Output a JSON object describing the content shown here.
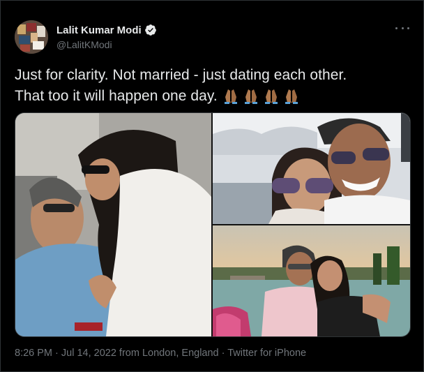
{
  "author": {
    "name": "Lalit Kumar Modi",
    "handle": "@LalitKModi",
    "verified": true
  },
  "tweet": {
    "line1": "Just for clarity. Not married - just dating each other.",
    "line2": "That too it will happen one day.",
    "emoji": [
      "folded-hands-icon",
      "folded-hands-icon",
      "folded-hands-icon",
      "folded-hands-icon"
    ]
  },
  "media": {
    "photos": [
      {
        "name": "photo-couple-embrace"
      },
      {
        "name": "photo-couple-selfie"
      },
      {
        "name": "photo-couple-lakeside"
      }
    ]
  },
  "meta": {
    "time": "8:26 PM",
    "sep1": " · ",
    "date": "Jul 14, 2022",
    "location": " from London, England",
    "sep2": " · ",
    "source": "Twitter for iPhone"
  },
  "colors": {
    "background": "#000000",
    "text": "#e7e9ea",
    "muted": "#71767b",
    "border": "#2f3336",
    "verified": "#e7e9ea"
  }
}
